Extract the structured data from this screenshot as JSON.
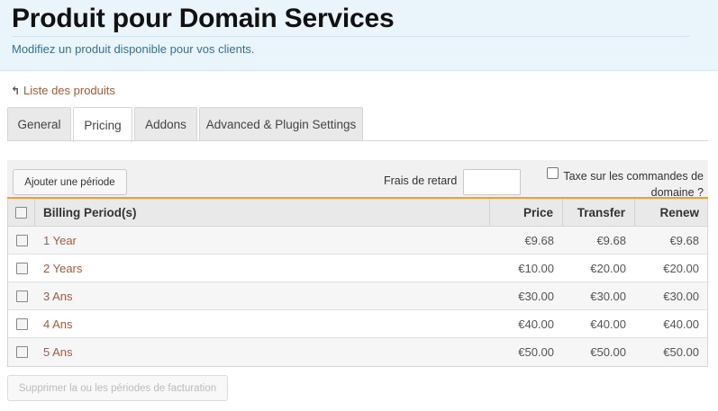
{
  "header": {
    "title": "Produit pour Domain Services",
    "subtitle": "Modifiez un produit disponible pour vos clients."
  },
  "back_link": {
    "icon": "arrow-up-left-icon",
    "label": "Liste des produits"
  },
  "tabs": [
    {
      "label": "General",
      "active": false
    },
    {
      "label": "Pricing",
      "active": true
    },
    {
      "label": "Addons",
      "active": false
    },
    {
      "label": "Advanced & Plugin Settings",
      "active": false
    }
  ],
  "toolbar": {
    "add_period_label": "Ajouter une période",
    "late_fee_label": "Frais de retard",
    "late_fee_value": "",
    "tax_label": "Taxe sur les commandes de domaine ?",
    "tax_checked": false
  },
  "table": {
    "columns": {
      "period": "Billing Period(s)",
      "price": "Price",
      "transfer": "Transfer",
      "renew": "Renew"
    },
    "rows": [
      {
        "period": "1 Year",
        "price": "€9.68",
        "transfer": "€9.68",
        "renew": "€9.68"
      },
      {
        "period": "2 Years",
        "price": "€10.00",
        "transfer": "€20.00",
        "renew": "€20.00"
      },
      {
        "period": "3 Ans",
        "price": "€30.00",
        "transfer": "€30.00",
        "renew": "€30.00"
      },
      {
        "period": "4 Ans",
        "price": "€40.00",
        "transfer": "€40.00",
        "renew": "€40.00"
      },
      {
        "period": "5 Ans",
        "price": "€50.00",
        "transfer": "€50.00",
        "renew": "€50.00"
      }
    ]
  },
  "delete_button_label": "Supprimer la ou les périodes de facturation",
  "colors": {
    "link": "#a65a3c",
    "accent_border": "#f0a030",
    "header_bg": "#eaf4fb"
  }
}
